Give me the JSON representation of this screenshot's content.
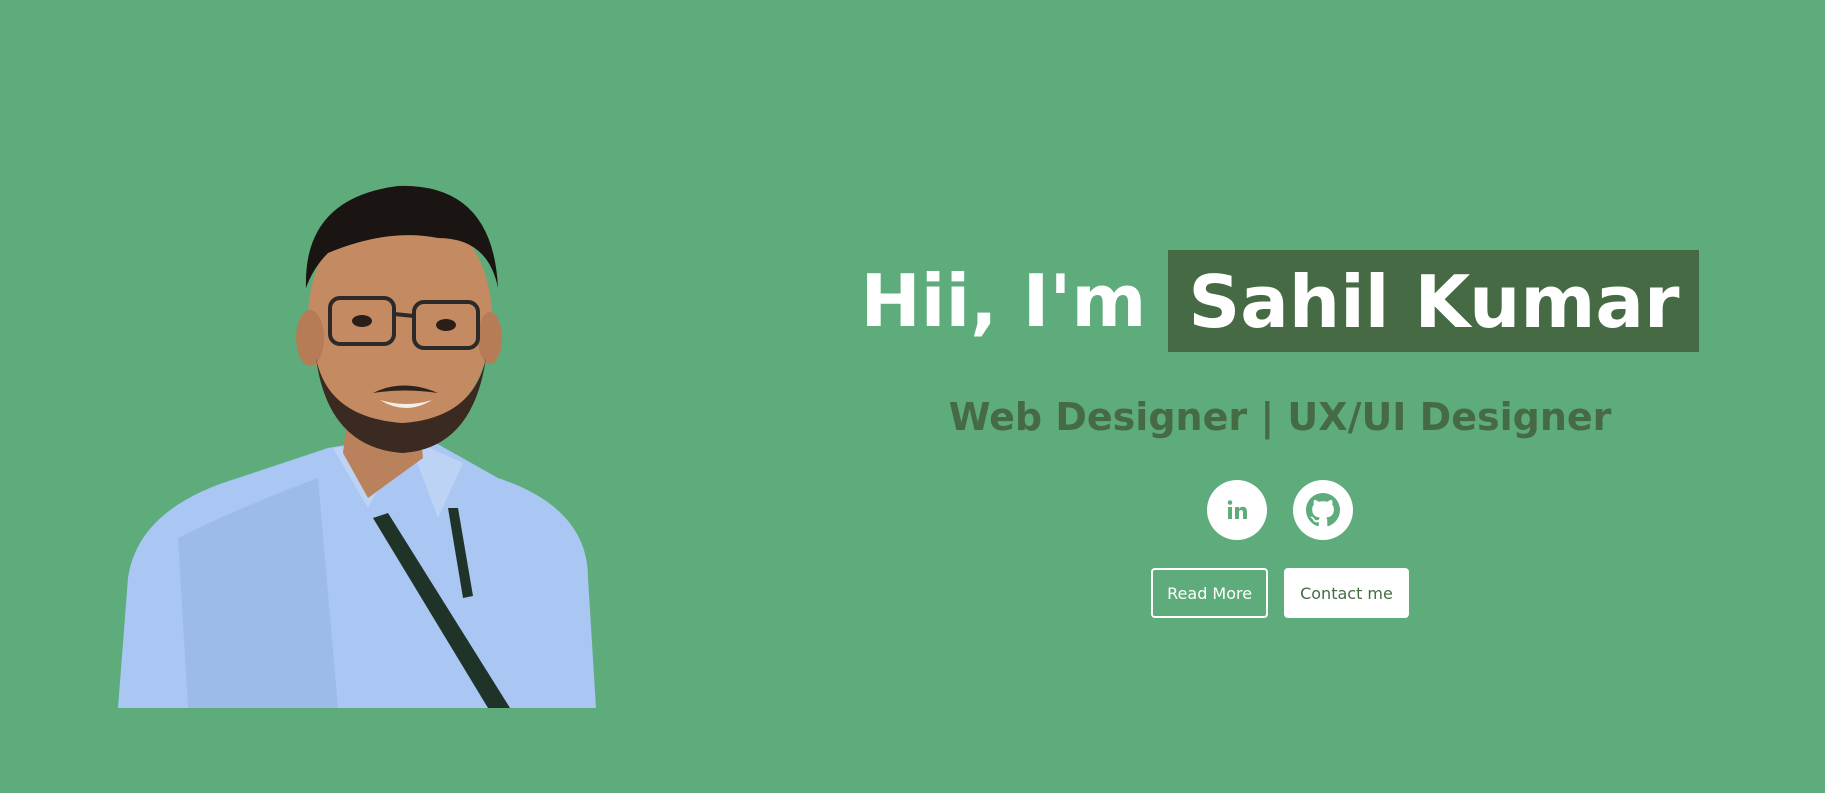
{
  "colors": {
    "background": "#5eac7c",
    "accent": "#466b44",
    "text_light": "#ffffff"
  },
  "hero": {
    "greeting": "Hii, I'm",
    "name": "Sahil Kumar",
    "subtitle": "Web Designer | UX/UI Designer",
    "portrait_alt": "portrait-photo"
  },
  "socials": [
    {
      "icon": "linkedin-icon",
      "label": "in"
    },
    {
      "icon": "github-icon",
      "label": ""
    }
  ],
  "buttons": {
    "read_more": "Read More",
    "contact": "Contact me"
  }
}
